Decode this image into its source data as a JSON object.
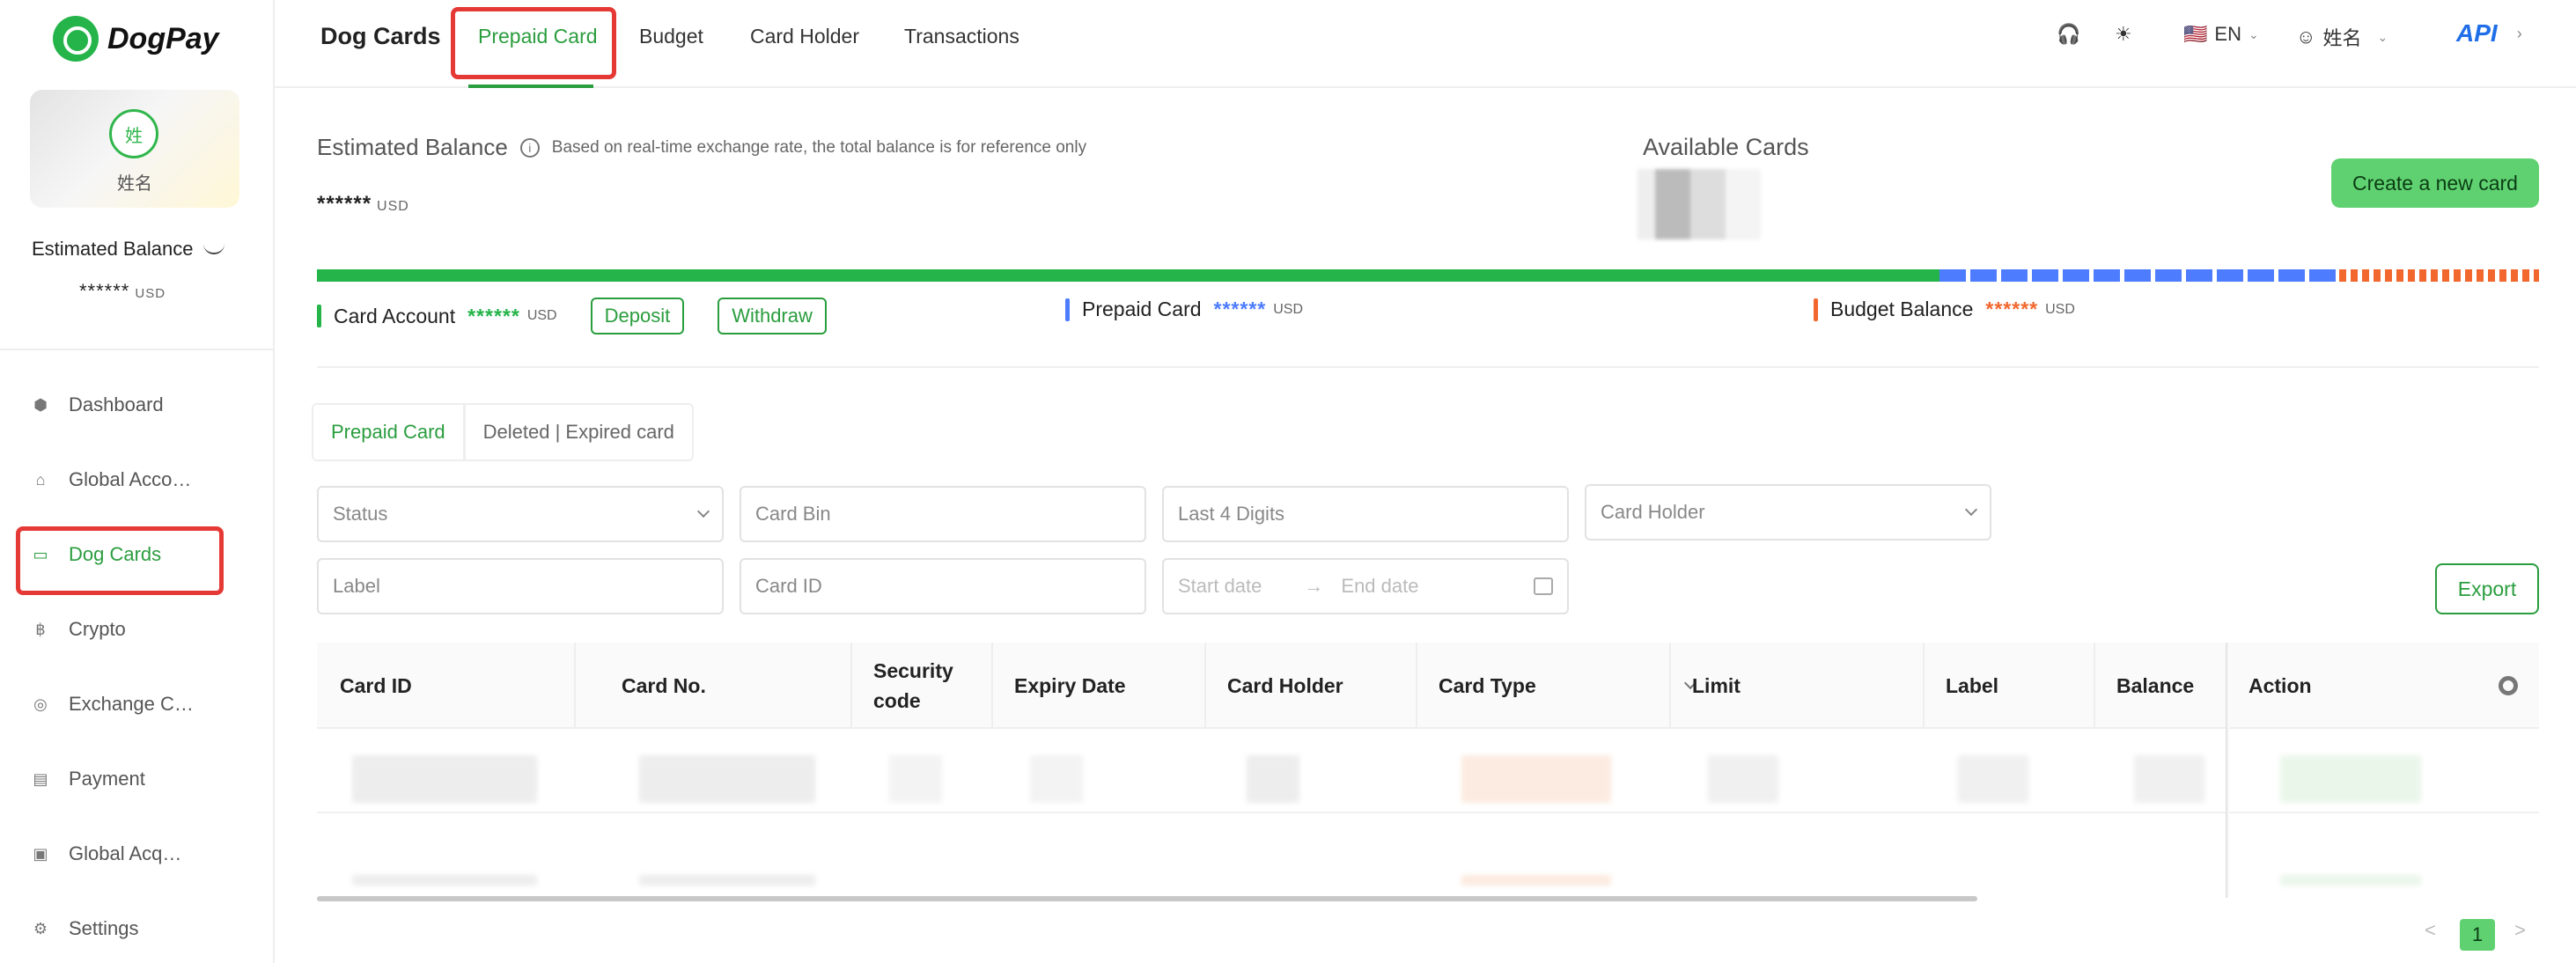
{
  "brand": {
    "name": "DogPay"
  },
  "user": {
    "avatar_text": "姓",
    "name": "姓名"
  },
  "sidebar": {
    "balance_label": "Estimated Balance",
    "balance_value": "******",
    "balance_unit": "USD",
    "items": [
      {
        "label": "Dashboard",
        "icon": "dashboard-icon"
      },
      {
        "label": "Global Acco…",
        "icon": "bank-icon"
      },
      {
        "label": "Dog Cards",
        "icon": "card-icon",
        "active": true
      },
      {
        "label": "Crypto",
        "icon": "bitcoin-icon"
      },
      {
        "label": "Exchange C…",
        "icon": "exchange-icon"
      },
      {
        "label": "Payment",
        "icon": "payment-icon"
      },
      {
        "label": "Global Acq…",
        "icon": "acquiring-icon"
      },
      {
        "label": "Settings",
        "icon": "gear-icon"
      }
    ]
  },
  "topbar": {
    "title": "Dog Cards",
    "tabs": [
      {
        "label": "Prepaid Card",
        "active": true
      },
      {
        "label": "Budget"
      },
      {
        "label": "Card Holder"
      },
      {
        "label": "Transactions"
      }
    ],
    "language": "EN",
    "user_name": "姓名",
    "api_label": "API"
  },
  "balance": {
    "title": "Estimated Balance",
    "note": "Based on real-time exchange rate, the total balance is for reference only",
    "value": "******",
    "unit": "USD",
    "available_cards_title": "Available Cards",
    "create_button": "Create a new card",
    "progress": {
      "card_account": 0.73,
      "prepaid_card": 0.18,
      "budget_balance": 0.09
    },
    "legend": {
      "card_account": {
        "label": "Card Account",
        "value": "******",
        "unit": "USD",
        "deposit": "Deposit",
        "withdraw": "Withdraw"
      },
      "prepaid_card": {
        "label": "Prepaid Card",
        "value": "******",
        "unit": "USD"
      },
      "budget_balance": {
        "label": "Budget Balance",
        "value": "******",
        "unit": "USD"
      }
    }
  },
  "card_tabs": [
    {
      "label": "Prepaid Card",
      "active": true
    },
    {
      "label": "Deleted | Expired card"
    }
  ],
  "filters": {
    "status": "Status",
    "card_bin": "Card Bin",
    "last4": "Last 4 Digits",
    "card_holder": "Card Holder",
    "label": "Label",
    "card_id": "Card ID",
    "start_date": "Start date",
    "end_date": "End date",
    "arrow": "→",
    "export": "Export"
  },
  "table": {
    "columns": [
      "Card ID",
      "Card No.",
      "Security code",
      "Expiry Date",
      "Card Holder",
      "Card Type",
      "Limit",
      "Label",
      "Balance",
      "Action"
    ]
  },
  "pagination": {
    "prev": "<",
    "current": "1",
    "next": ">"
  },
  "colors": {
    "brand_green": "#25b44a",
    "blue": "#4d7cff",
    "orange": "#f2672e",
    "highlight_red": "#e53935"
  }
}
